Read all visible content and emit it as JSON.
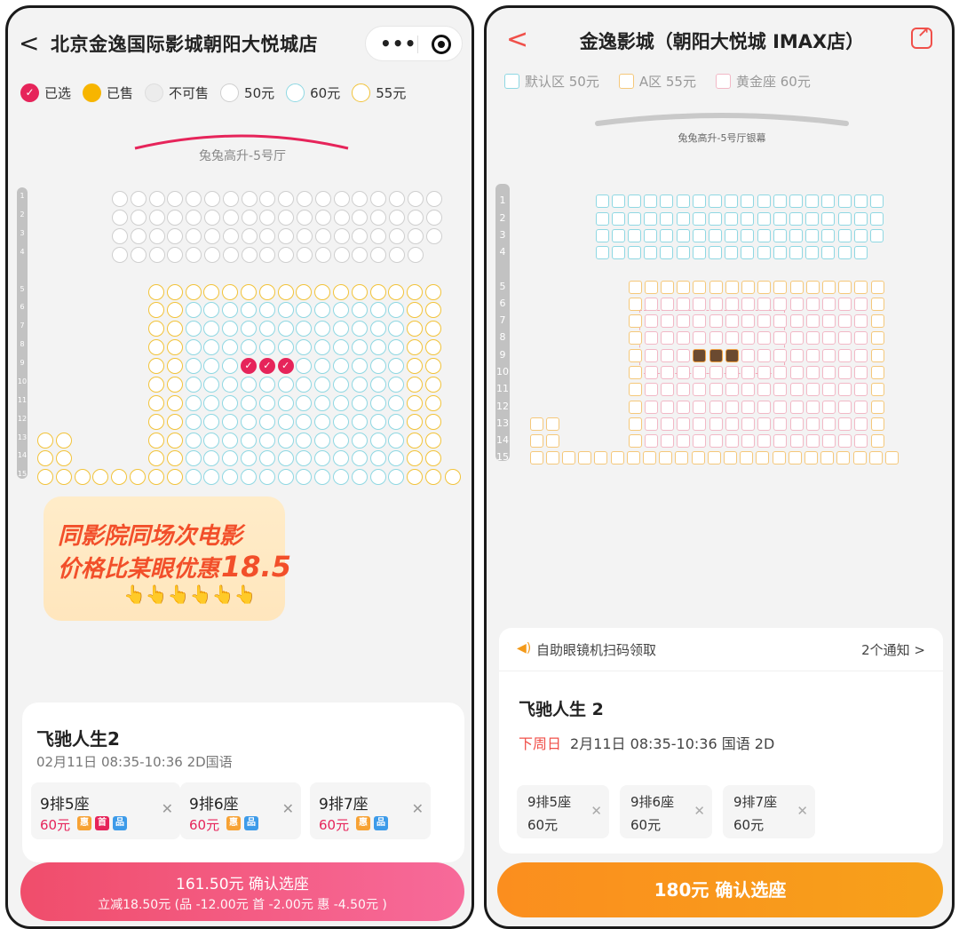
{
  "left": {
    "header": {
      "back": "<",
      "title": "北京金逸国际影城朝阳大悦城店"
    },
    "legend": [
      {
        "label": "已选",
        "style": "selected"
      },
      {
        "label": "已售",
        "style": "sold"
      },
      {
        "label": "不可售",
        "style": "unavailable"
      },
      {
        "label": "50元",
        "style": "white"
      },
      {
        "label": "60元",
        "style": "cyan"
      },
      {
        "label": "55元",
        "style": "yellow"
      }
    ],
    "screen_label": "兔兔高升-5号厅",
    "row_numbers": [
      "1",
      "2",
      "3",
      "4",
      "5",
      "6",
      "7",
      "8",
      "9",
      "10",
      "11",
      "12",
      "13",
      "14",
      "15"
    ],
    "promo": {
      "line1": "同影院同场次电影",
      "line2": "价格比某眼优惠",
      "amount": "18.5",
      "hands": "👆👆👆👆👆👆"
    },
    "movie": {
      "title": "飞驰人生2",
      "time": "02月11日 08:35-10:36 2D国语"
    },
    "tickets": [
      {
        "seat": "9排5座",
        "price": "60元",
        "tags": [
          "惠",
          "首",
          "品"
        ]
      },
      {
        "seat": "9排6座",
        "price": "60元",
        "tags": [
          "惠",
          "品"
        ]
      },
      {
        "seat": "9排7座",
        "price": "60元",
        "tags": [
          "惠",
          "品"
        ]
      }
    ],
    "confirm": {
      "main": "161.50元 确认选座",
      "sub": "立减18.50元 (品 -12.00元 首 -2.00元 惠 -4.50元 )"
    },
    "colors": {
      "selected": "#e6245a",
      "sold": "#f7b500",
      "cyan": "#8fd8e3",
      "yellow": "#f2c33a"
    }
  },
  "right": {
    "header": {
      "back": "<",
      "title": "金逸影城（朝阳大悦城 IMAX店）",
      "share_icon": "share-icon"
    },
    "legend": [
      {
        "label": "默认区 50元",
        "color": "#8fd8e3"
      },
      {
        "label": "A区 55元",
        "color": "#f5c87a"
      },
      {
        "label": "黄金座 60元",
        "color": "#f2b8c6"
      }
    ],
    "screen_label": "兔兔高升-5号厅银幕",
    "row_numbers": [
      "1",
      "2",
      "3",
      "4",
      "5",
      "6",
      "7",
      "8",
      "9",
      "10",
      "11",
      "12",
      "13",
      "14",
      "15"
    ],
    "notice": {
      "text": "自助眼镜机扫码领取",
      "count": "2个通知 >"
    },
    "movie": {
      "title": "飞驰人生 2",
      "day": "下周日",
      "time": "2月11日  08:35-10:36  国语 2D"
    },
    "tickets": [
      {
        "seat": "9排5座",
        "price": "60元"
      },
      {
        "seat": "9排6座",
        "price": "60元"
      },
      {
        "seat": "9排7座",
        "price": "60元"
      }
    ],
    "confirm": "180元 确认选座"
  }
}
